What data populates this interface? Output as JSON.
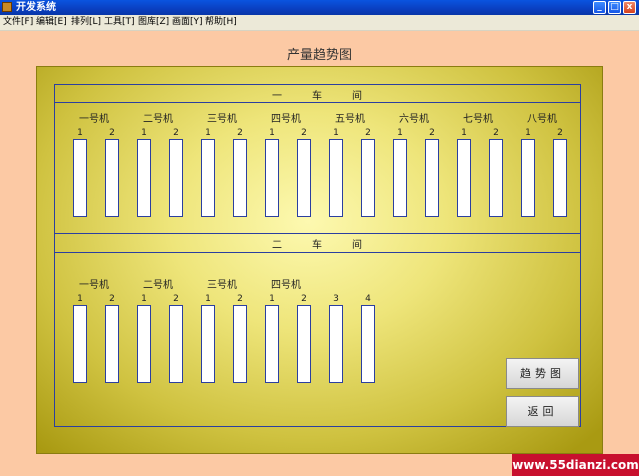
{
  "window": {
    "title": "开发系统",
    "controls": [
      "_",
      "□",
      "x"
    ]
  },
  "menu": [
    "文件[F]",
    "编辑[E]",
    "排列[L]",
    "工具[T]",
    "图库[Z]",
    "画面[Y]",
    "帮助[H]"
  ],
  "page_title": "产量趋势图",
  "workshops": [
    {
      "name_chars": [
        "一",
        "车",
        "间"
      ],
      "machines": [
        {
          "name": "一号机",
          "slots": [
            "1",
            "2"
          ]
        },
        {
          "name": "二号机",
          "slots": [
            "1",
            "2"
          ]
        },
        {
          "name": "三号机",
          "slots": [
            "1",
            "2"
          ]
        },
        {
          "name": "四号机",
          "slots": [
            "1",
            "2"
          ]
        },
        {
          "name": "五号机",
          "slots": [
            "1",
            "2"
          ]
        },
        {
          "name": "六号机",
          "slots": [
            "1",
            "2"
          ]
        },
        {
          "name": "七号机",
          "slots": [
            "1",
            "2"
          ]
        },
        {
          "name": "八号机",
          "slots": [
            "1",
            "2"
          ]
        }
      ]
    },
    {
      "name_chars": [
        "二",
        "车",
        "间"
      ],
      "machines": [
        {
          "name": "一号机",
          "slots": [
            "1",
            "2"
          ]
        },
        {
          "name": "二号机",
          "slots": [
            "1",
            "2"
          ]
        },
        {
          "name": "三号机",
          "slots": [
            "1",
            "2"
          ]
        },
        {
          "name": "四号机",
          "slots": [
            "1",
            "2",
            "3",
            "4"
          ]
        }
      ]
    }
  ],
  "buttons": {
    "trend": "趋势图",
    "back": "返回"
  },
  "watermark": "www.55dianzi.com",
  "colors": {
    "panel_gold": "#e8de6c",
    "frame_blue": "#2b3fa0",
    "background_peach": "#fcc9a4"
  }
}
